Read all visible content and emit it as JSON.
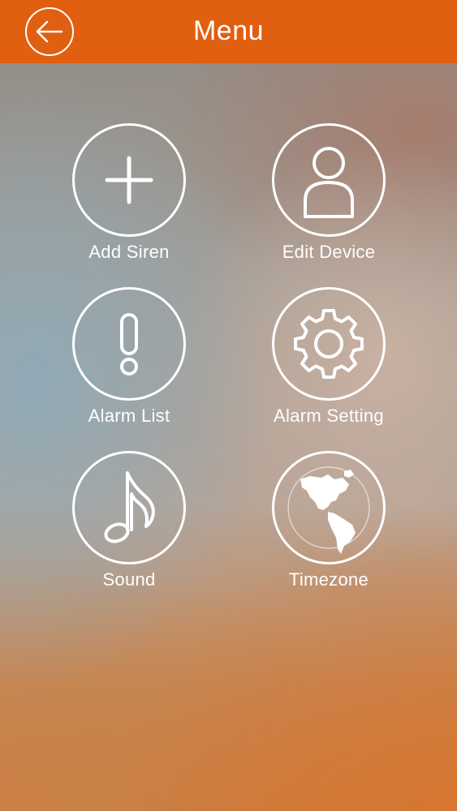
{
  "header": {
    "title": "Menu",
    "back_icon": "arrow-left-icon",
    "background_color": "#e15f10"
  },
  "menu": {
    "items": [
      {
        "label": "Add Siren",
        "icon": "plus-icon"
      },
      {
        "label": "Edit Device",
        "icon": "user-icon"
      },
      {
        "label": "Alarm List",
        "icon": "exclamation-icon"
      },
      {
        "label": "Alarm Setting",
        "icon": "gear-icon"
      },
      {
        "label": "Sound",
        "icon": "music-note-icon"
      },
      {
        "label": "Timezone",
        "icon": "globe-icon"
      }
    ]
  }
}
